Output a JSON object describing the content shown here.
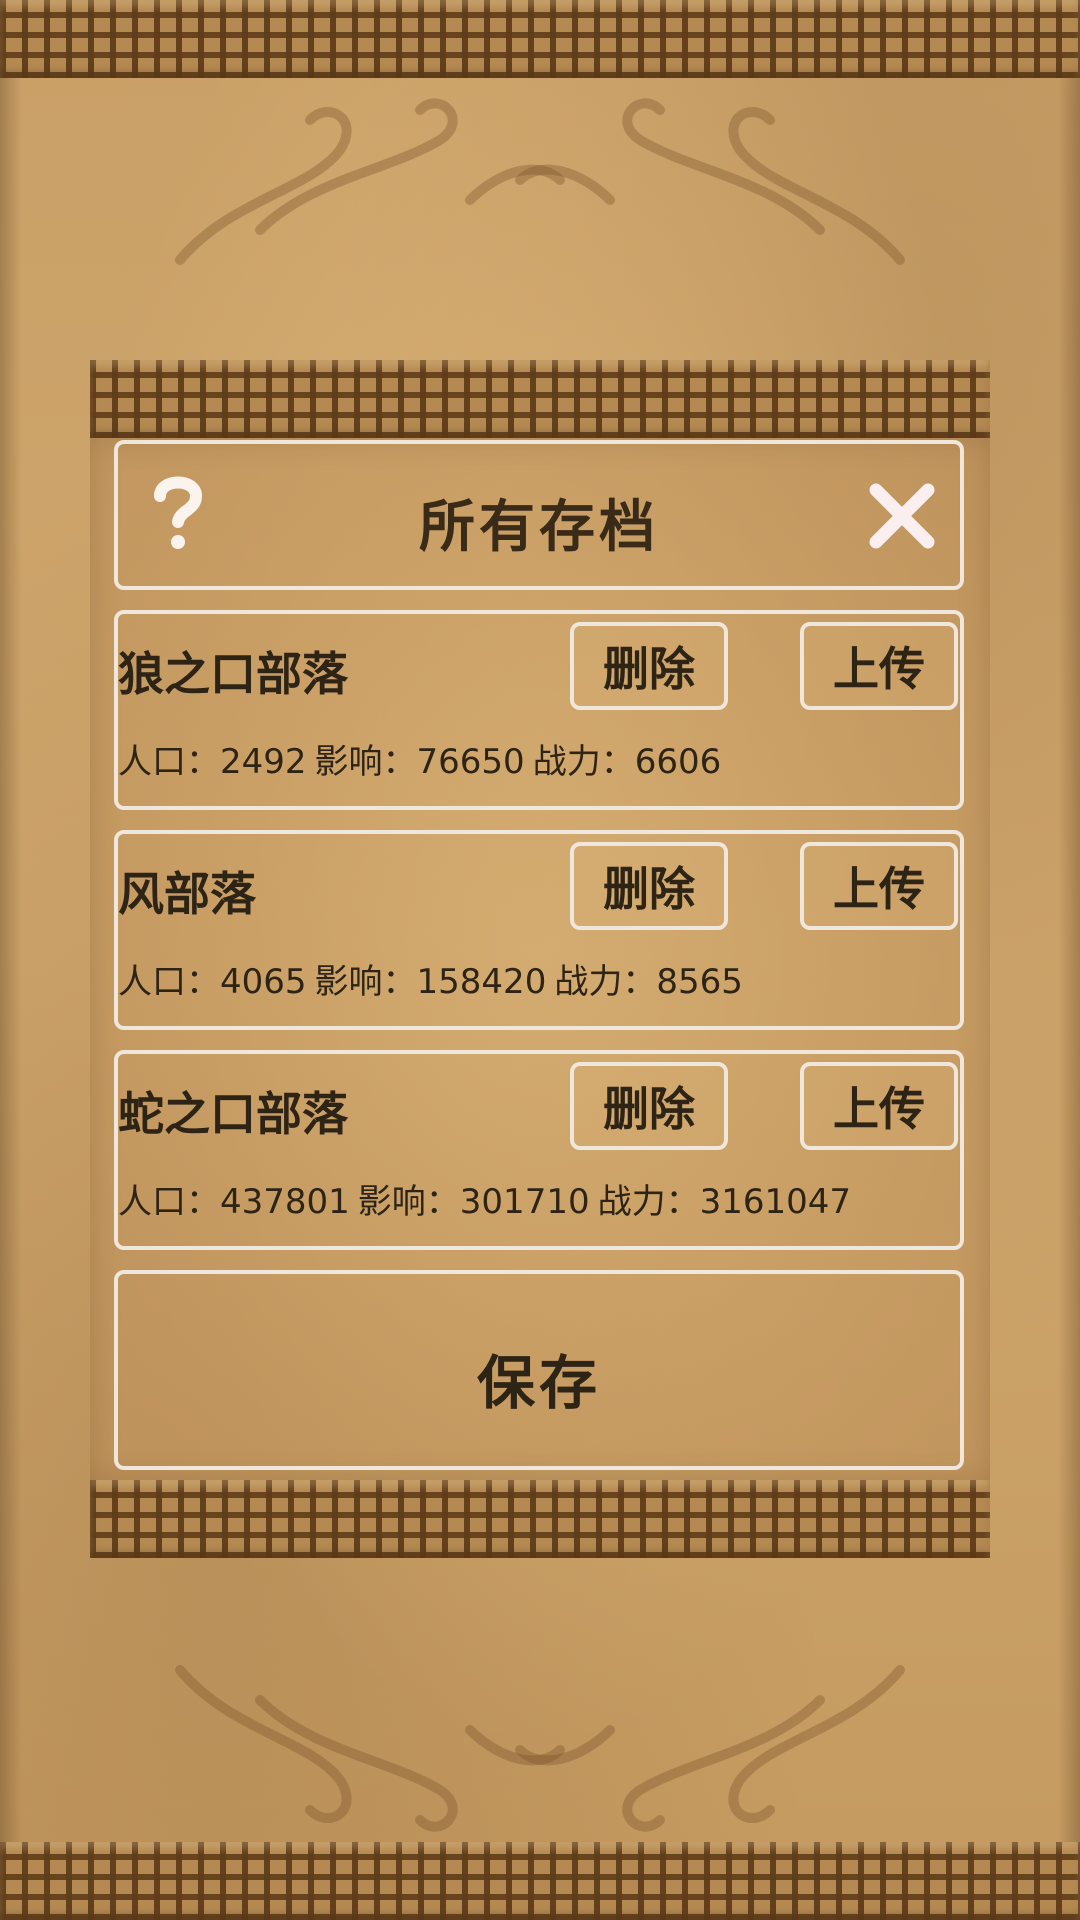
{
  "dialog": {
    "title": "所有存档",
    "help_icon": "question-icon",
    "close_icon": "close-icon"
  },
  "saves": [
    {
      "name": "狼之口部落",
      "delete_label": "删除",
      "upload_label": "上传",
      "population_label": "人口：",
      "population": "2492",
      "influence_label": "影响：",
      "influence": "76650",
      "power_label": "战力：",
      "power": "6606"
    },
    {
      "name": "风部落",
      "delete_label": "删除",
      "upload_label": "上传",
      "population_label": "人口：",
      "population": "4065",
      "influence_label": "影响：",
      "influence": "158420",
      "power_label": "战力：",
      "power": "8565"
    },
    {
      "name": "蛇之口部落",
      "delete_label": "删除",
      "upload_label": "上传",
      "population_label": "人口：",
      "population": "437801",
      "influence_label": "影响：",
      "influence": "301710",
      "power_label": "战力：",
      "power": "3161047"
    }
  ],
  "save_button": {
    "label": "保存"
  },
  "colors": {
    "parchment": "#c89b5e",
    "border": "#efe6dc",
    "text": "#2e2416",
    "fret": "#5f3c19"
  }
}
